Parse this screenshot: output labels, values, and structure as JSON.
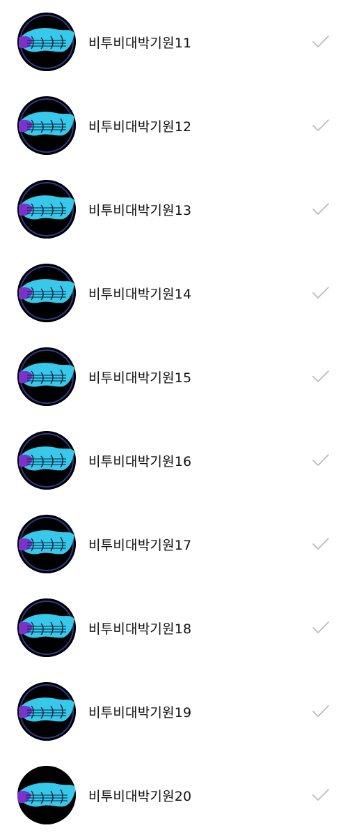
{
  "accent": {
    "cyan": "#37c8ea",
    "purple": "#7a33c9",
    "check_gray": "#b7b7b7"
  },
  "items": [
    {
      "name": "비투비대박기원11",
      "avatar_icon": "music-logo-avatar",
      "ring": true
    },
    {
      "name": "비투비대박기원12",
      "avatar_icon": "music-logo-avatar",
      "ring": true
    },
    {
      "name": "비투비대박기원13",
      "avatar_icon": "music-logo-avatar",
      "ring": true
    },
    {
      "name": "비투비대박기원14",
      "avatar_icon": "music-logo-avatar",
      "ring": true
    },
    {
      "name": "비투비대박기원15",
      "avatar_icon": "music-logo-avatar",
      "ring": true
    },
    {
      "name": "비투비대박기원16",
      "avatar_icon": "music-logo-avatar",
      "ring": true
    },
    {
      "name": "비투비대박기원17",
      "avatar_icon": "music-logo-avatar",
      "ring": true
    },
    {
      "name": "비투비대박기원18",
      "avatar_icon": "music-logo-avatar",
      "ring": true
    },
    {
      "name": "비투비대박기원19",
      "avatar_icon": "music-logo-avatar",
      "ring": true
    },
    {
      "name": "비투비대박기원20",
      "avatar_icon": "music-logo-avatar",
      "ring": false
    }
  ]
}
